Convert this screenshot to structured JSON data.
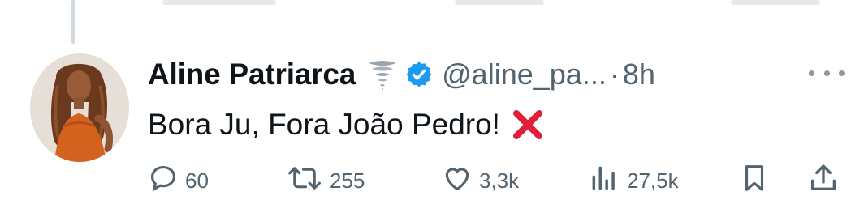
{
  "tweet": {
    "author_name": "Aline Patriarca",
    "author_emoji": "tornado-emoji",
    "verified": true,
    "handle": "@aline_pa...",
    "separator": "·",
    "time": "8h",
    "text": "Bora Ju, Fora João Pedro!",
    "text_emoji": "cross-mark-emoji"
  },
  "actions": {
    "replies": "60",
    "retweets": "255",
    "likes": "3,3k",
    "views": "27,5k"
  },
  "colors": {
    "text": "#0f1419",
    "secondary": "#536471",
    "verified_blue": "#1d9bf0",
    "cross_red": "#e0203a",
    "thread_line": "#cfd9de"
  },
  "icons": [
    "reply-icon",
    "retweet-icon",
    "like-icon",
    "views-icon",
    "bookmark-icon",
    "share-icon",
    "more-icon"
  ]
}
